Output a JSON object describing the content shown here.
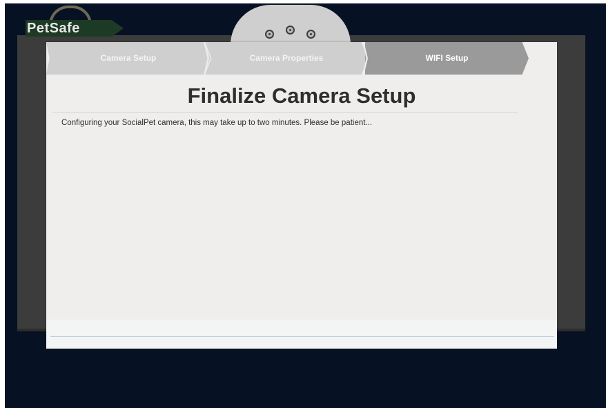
{
  "brand": {
    "logo_text": "PetSafe"
  },
  "wizard": {
    "steps": [
      {
        "label": "Camera Setup",
        "state": "complete"
      },
      {
        "label": "Camera Properties",
        "state": "complete"
      },
      {
        "label": "WIFI Setup",
        "state": "active"
      }
    ]
  },
  "content": {
    "title": "Finalize Camera Setup",
    "status_message": "Configuring your SocialPet camera, this may take up to two minutes. Please be patient..."
  },
  "icons": {
    "camera_lenses": [
      "camera-lens-icon",
      "camera-lens-icon",
      "camera-lens-icon"
    ]
  },
  "colors": {
    "page_background": "#061224",
    "panel_background": "#3c3c3c",
    "modal_background": "#efeeed",
    "step_inactive": "#cfcfcf",
    "step_active": "#9a9a9a",
    "brand_badge": "#1d3a24"
  }
}
